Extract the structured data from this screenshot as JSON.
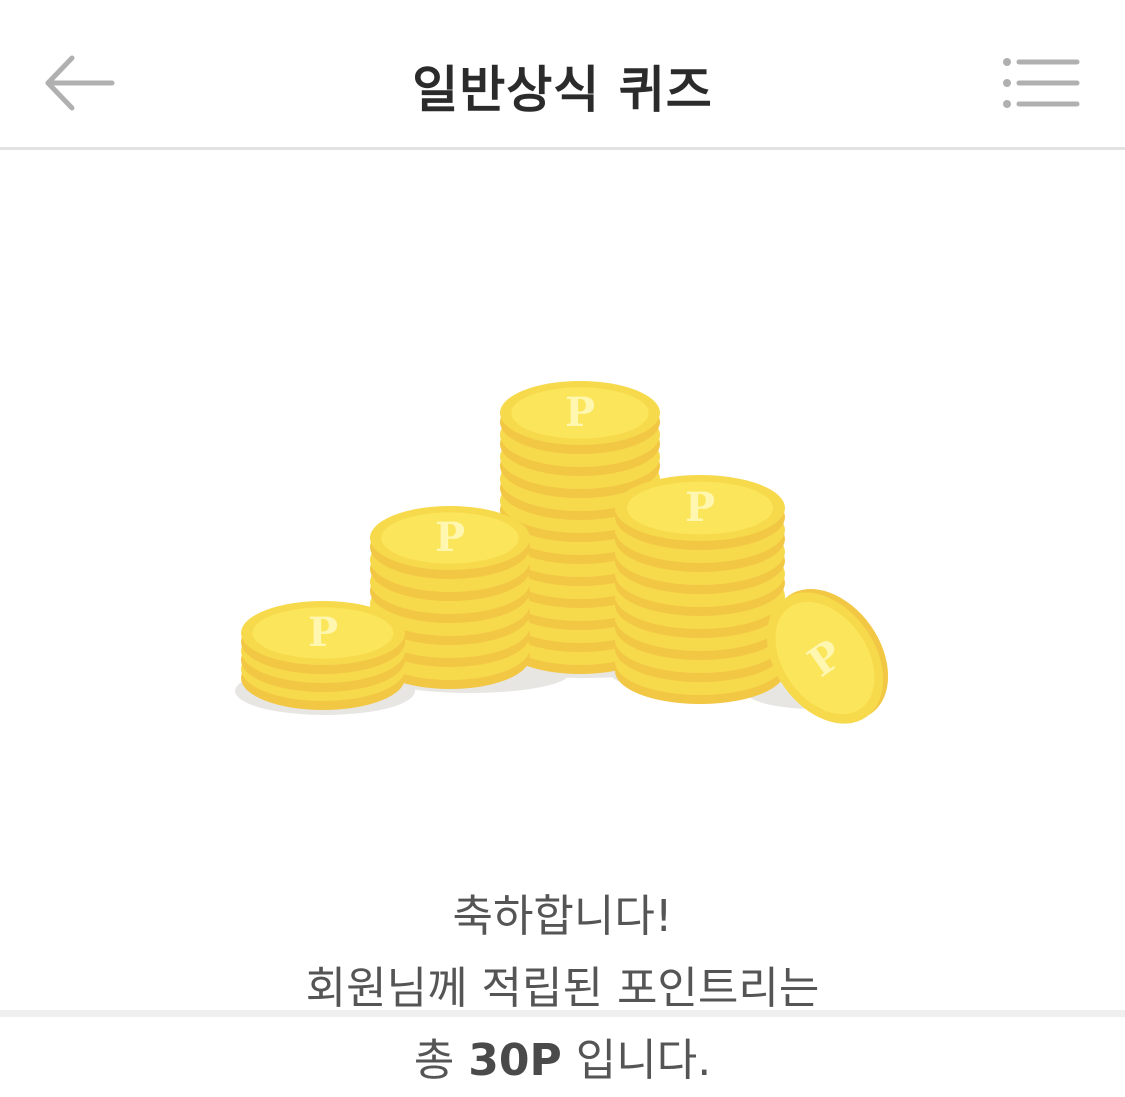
{
  "header": {
    "title": "일반상식 퀴즈",
    "back_icon": "arrow-left-icon",
    "menu_icon": "list-menu-icon"
  },
  "reward": {
    "illustration": "coin-stack-icon",
    "line1": "축하합니다!",
    "line2": "회원님께 적립된 포인트리는",
    "line3_prefix": "총 ",
    "points": "30P",
    "line3_suffix": " 입니다.",
    "coin_letter": "P"
  },
  "colors": {
    "coin_face": "#fbe55a",
    "coin_rim": "#f2c744",
    "coin_edge": "#f7d94c",
    "shadow": "#e8e6e3",
    "text": "#555555",
    "title": "#2b2b2b",
    "icon": "#b0b0b0"
  }
}
